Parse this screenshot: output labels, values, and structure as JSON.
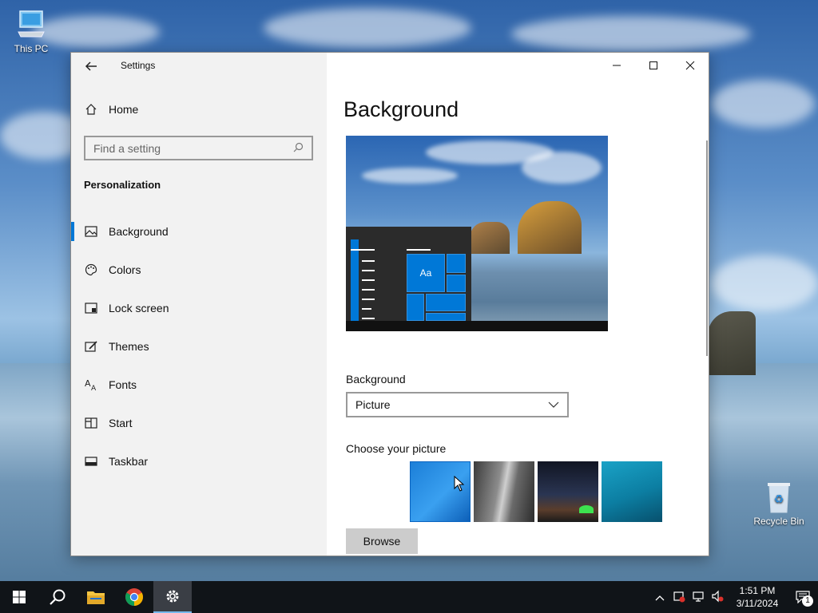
{
  "desktop": {
    "icons": [
      {
        "label": "This PC"
      },
      {
        "label": "Recycle Bin"
      }
    ]
  },
  "window": {
    "title": "Settings",
    "minimize": "—",
    "maximize": "☐",
    "close": "✕"
  },
  "sidebar": {
    "home_label": "Home",
    "search_placeholder": "Find a setting",
    "section_title": "Personalization",
    "items": [
      {
        "label": "Background",
        "icon": "image-icon",
        "active": true
      },
      {
        "label": "Colors",
        "icon": "palette-icon",
        "active": false
      },
      {
        "label": "Lock screen",
        "icon": "lock-screen-icon",
        "active": false
      },
      {
        "label": "Themes",
        "icon": "themes-icon",
        "active": false
      },
      {
        "label": "Fonts",
        "icon": "fonts-icon",
        "active": false
      },
      {
        "label": "Start",
        "icon": "start-icon",
        "active": false
      },
      {
        "label": "Taskbar",
        "icon": "taskbar-icon",
        "active": false
      }
    ]
  },
  "main": {
    "page_title": "Background",
    "preview_tile_text": "Aa",
    "background_label": "Background",
    "background_value": "Picture",
    "choose_label": "Choose your picture",
    "browse_label": "Browse"
  },
  "taskbar": {
    "time": "1:51 PM",
    "date": "3/11/2024",
    "notification_count": "1"
  },
  "colors": {
    "accent": "#0078d7",
    "taskbar": "#101418",
    "sidebar": "#f2f2f2"
  }
}
